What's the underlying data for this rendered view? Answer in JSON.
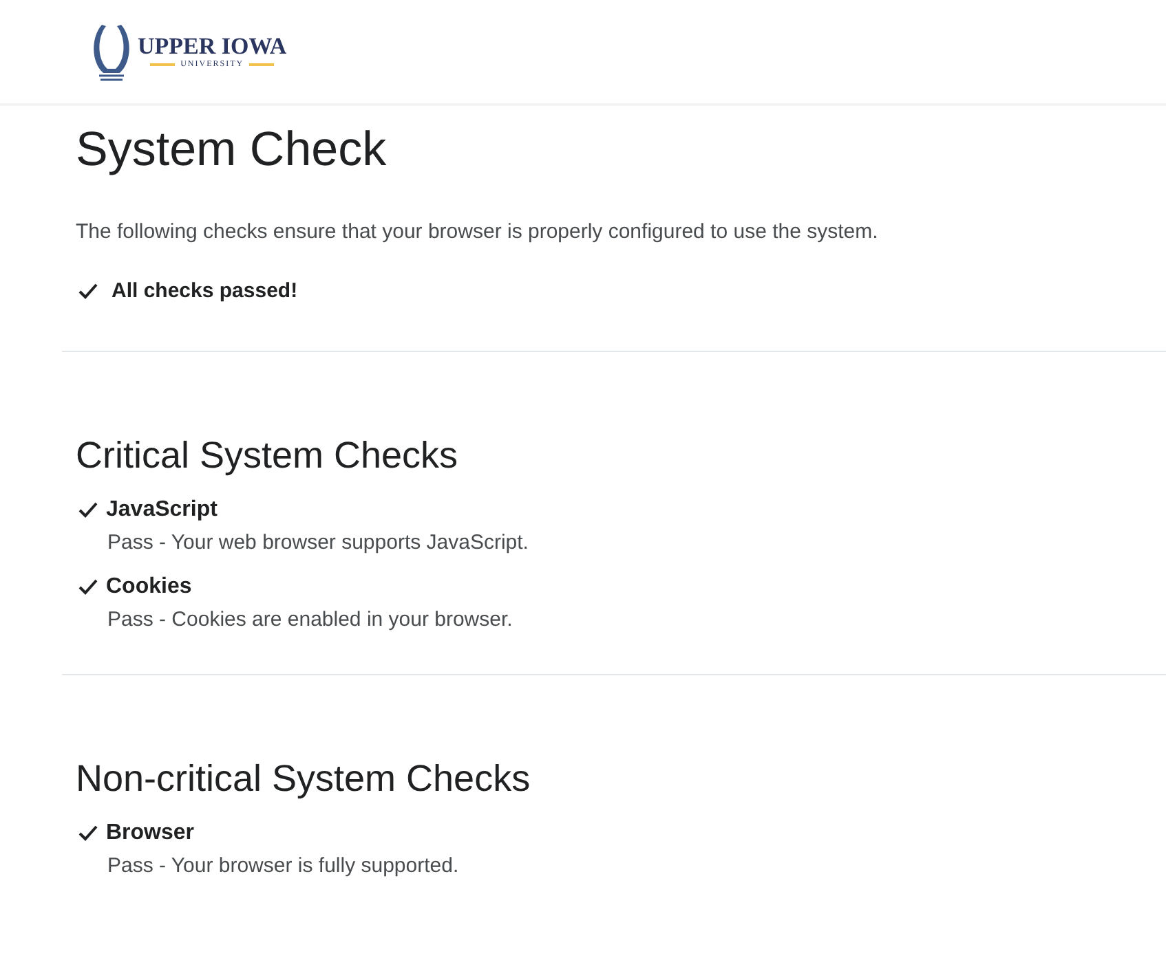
{
  "header": {
    "logo": {
      "name": "UPPER IOWA",
      "subtitle": "UNIVERSITY"
    }
  },
  "title": "System Check",
  "intro": "The following checks ensure that your browser is properly configured to use the system.",
  "summary": {
    "text": "All checks passed!",
    "passed": true
  },
  "sections": [
    {
      "heading": "Critical System Checks",
      "checks": [
        {
          "name": "JavaScript",
          "result": "Pass - Your web browser supports JavaScript.",
          "passed": true
        },
        {
          "name": "Cookies",
          "result": "Pass - Cookies are enabled in your browser.",
          "passed": true
        }
      ]
    },
    {
      "heading": "Non-critical System Checks",
      "checks": [
        {
          "name": "Browser",
          "result": "Pass - Your browser is fully supported.",
          "passed": true
        }
      ]
    }
  ]
}
